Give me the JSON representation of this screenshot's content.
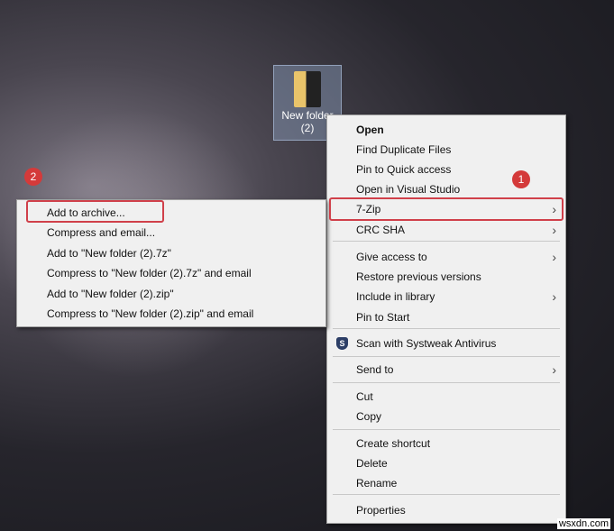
{
  "desktop_icon": {
    "label": "New folder (2)"
  },
  "badges": [
    "1",
    "2"
  ],
  "context_menu": {
    "items": [
      {
        "label": "Open",
        "bold": true
      },
      {
        "label": "Find Duplicate Files"
      },
      {
        "label": "Pin to Quick access"
      },
      {
        "label": "Open in Visual Studio"
      },
      {
        "label": "7-Zip",
        "submenu": true
      },
      {
        "label": "CRC SHA",
        "submenu": true
      },
      {
        "label": "Give access to",
        "submenu": true
      },
      {
        "label": "Restore previous versions"
      },
      {
        "label": "Include in library",
        "submenu": true
      },
      {
        "label": "Pin to Start"
      },
      {
        "label": "Scan with Systweak Antivirus",
        "icon": "shield-icon"
      },
      {
        "label": "Send to",
        "submenu": true
      },
      {
        "label": "Cut"
      },
      {
        "label": "Copy"
      },
      {
        "label": "Create shortcut"
      },
      {
        "label": "Delete"
      },
      {
        "label": "Rename"
      },
      {
        "label": "Properties"
      }
    ]
  },
  "zip_submenu": {
    "items": [
      "Add to archive...",
      "Compress and email...",
      "Add to \"New folder (2).7z\"",
      "Compress to \"New folder (2).7z\" and email",
      "Add to \"New folder (2).zip\"",
      "Compress to \"New folder (2).zip\" and email"
    ]
  },
  "watermark": "wsxdn.com",
  "colors": {
    "highlight": "#d0404a",
    "badge": "#d43a3a"
  }
}
